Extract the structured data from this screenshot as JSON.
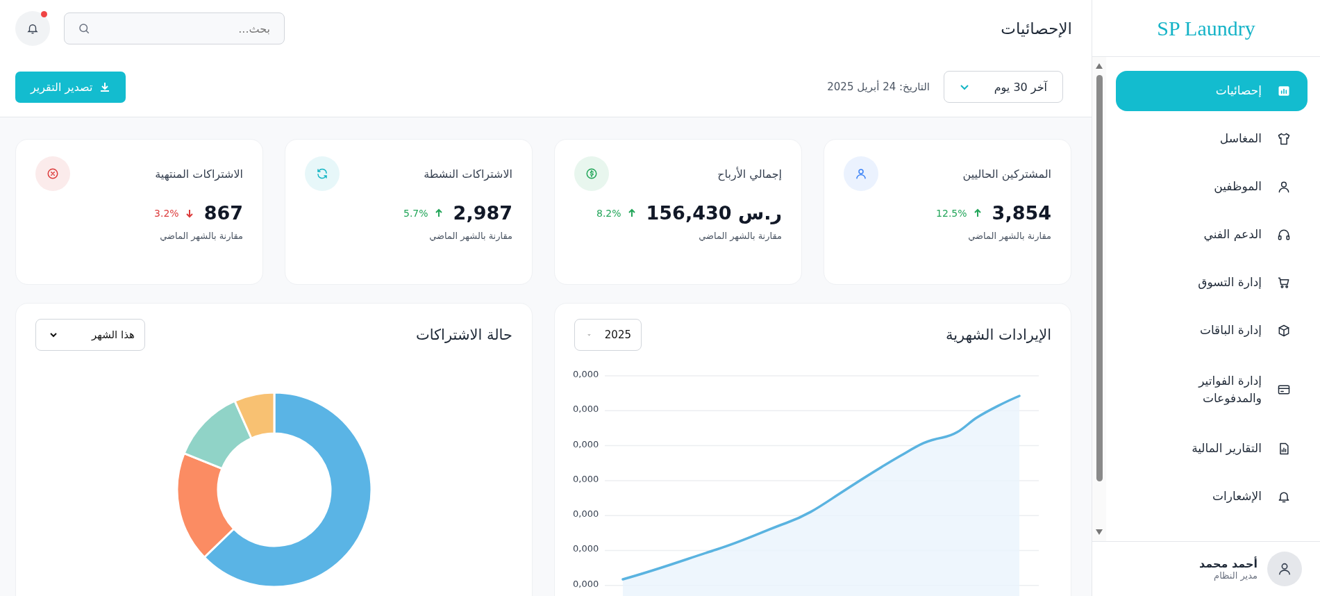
{
  "sidebar": {
    "logo": "SP Laundry",
    "items": [
      {
        "label": "إحصائيات",
        "selected": true
      },
      {
        "label": "المغاسل",
        "selected": false
      },
      {
        "label": "الموظفين",
        "selected": false
      },
      {
        "label": "الدعم الفني",
        "selected": false
      },
      {
        "label": "إدارة التسوق",
        "selected": false
      },
      {
        "label": "إدارة الباقات",
        "selected": false
      },
      {
        "label": "إدارة الفواتير والمدفوعات",
        "selected": false
      },
      {
        "label": "التقارير المالية",
        "selected": false
      },
      {
        "label": "الإشعارات",
        "selected": false
      }
    ],
    "user": {
      "name": "أحمد محمد",
      "role": "مدير النظام"
    }
  },
  "header": {
    "title": "الإحصائيات",
    "search": {
      "placeholder": "بحث..."
    },
    "notifications": {
      "unread": true
    }
  },
  "toolbar": {
    "range": "آخر 30 يوم",
    "date": "التاريخ: 24 أبريل 2025",
    "export": "تصدير التقرير"
  },
  "stats": [
    {
      "title": "المشتركين الحاليين",
      "value": "3,854",
      "change": "12.5%",
      "declining": false,
      "note": "مقارنة بالشهر الماضي",
      "color": "#3b82f6"
    },
    {
      "title": "إجمالي الأرباح",
      "value": "ر.س 156,430",
      "change": "8.2%",
      "declining": false,
      "note": "مقارنة بالشهر الماضي",
      "color": "#22a559"
    },
    {
      "title": "الاشتراكات النشطة",
      "value": "2,987",
      "change": "5.7%",
      "declining": false,
      "note": "مقارنة بالشهر الماضي",
      "color": "#13b5c4"
    },
    {
      "title": "الاشتراكات المنتهية",
      "value": "867",
      "change": "3.2%",
      "declining": true,
      "note": "مقارنة بالشهر الماضي",
      "color": "#dc3b3b"
    }
  ],
  "charts": [
    {
      "kind": "line",
      "title": "الإيرادات الشهرية",
      "filter": "2025",
      "y_labels": [
        "0,000",
        "0,000",
        "0,000",
        "0,000",
        "0,000",
        "0,000",
        "0,000"
      ]
    },
    {
      "kind": "donut",
      "title": "حالة الاشتراكات",
      "filter": "هذا الشهر"
    }
  ]
}
